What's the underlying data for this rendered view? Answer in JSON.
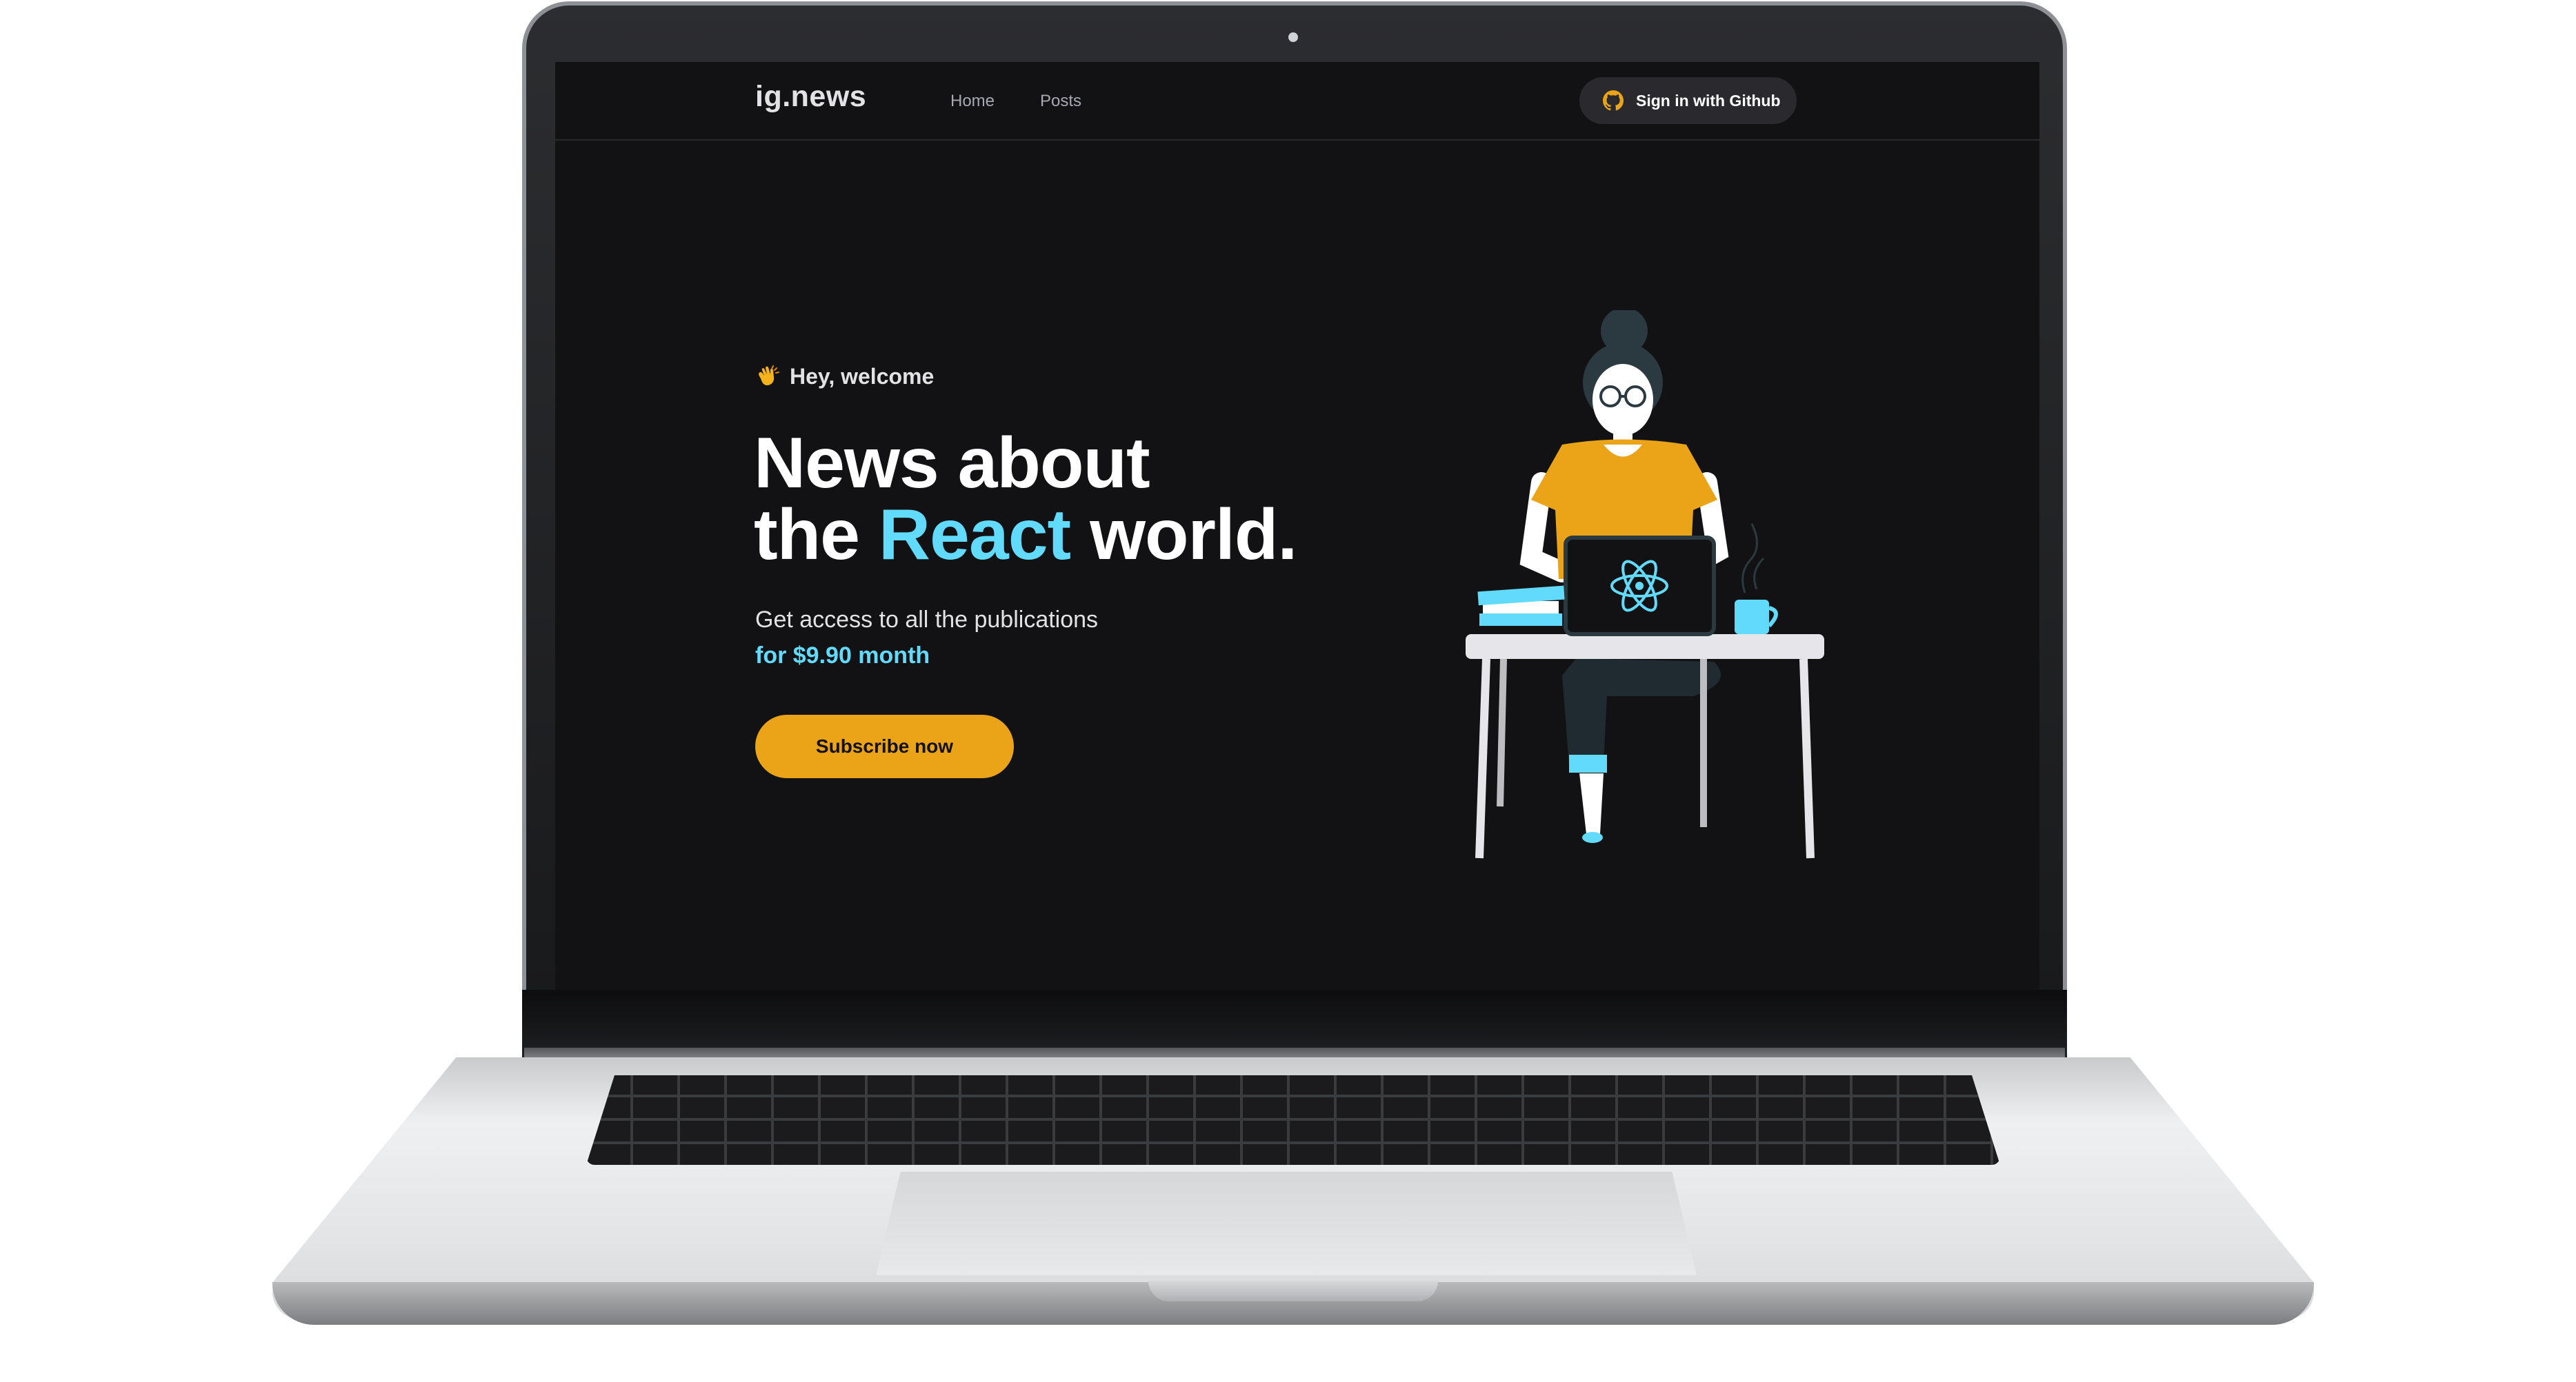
{
  "header": {
    "logo": "ig.news",
    "nav": [
      {
        "label": "Home"
      },
      {
        "label": "Posts"
      }
    ],
    "signin_label": "Sign in with Github"
  },
  "hero": {
    "greeting": "Hey, welcome",
    "headline_line1": "News about",
    "headline_prefix": "the ",
    "headline_accent": "React",
    "headline_suffix": " world.",
    "subtitle": "Get access to all the publications",
    "price": "for $9.90 month",
    "subscribe_label": "Subscribe now"
  },
  "icons": {
    "signin": "github-icon",
    "greeting": "clapping-hands-icon",
    "laptop_logo": "react-icon"
  },
  "colors": {
    "background": "#121214",
    "accent_cyan": "#61dafb",
    "accent_yellow": "#eba417",
    "text": "#e1e1e6",
    "header_border": "#29292e"
  }
}
